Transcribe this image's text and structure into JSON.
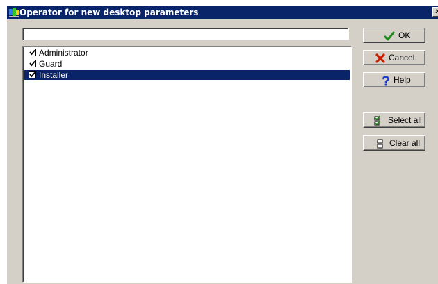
{
  "window": {
    "title": "Operator for new desktop parameters",
    "close_glyph": "×"
  },
  "filter": {
    "value": "",
    "placeholder": ""
  },
  "operators": [
    {
      "label": "Administrator",
      "checked": true,
      "selected": false
    },
    {
      "label": "Guard",
      "checked": true,
      "selected": false
    },
    {
      "label": "Installer",
      "checked": true,
      "selected": true
    }
  ],
  "buttons": {
    "ok": {
      "label": "OK",
      "icon": "checkmark-icon"
    },
    "cancel": {
      "label": "Cancel",
      "icon": "x-icon"
    },
    "help": {
      "label": "Help",
      "icon": "question-icon"
    },
    "select_all": {
      "label": "Select all",
      "icon": "select-all-icon"
    },
    "clear_all": {
      "label": "Clear all",
      "icon": "clear-all-icon"
    }
  },
  "colors": {
    "titlebar": "#0a246a",
    "selection": "#0a246a",
    "face": "#d4d0c8",
    "ok_icon": "#1a8a1a",
    "cancel_icon": "#c81e00",
    "help_icon": "#1e3cc8"
  }
}
